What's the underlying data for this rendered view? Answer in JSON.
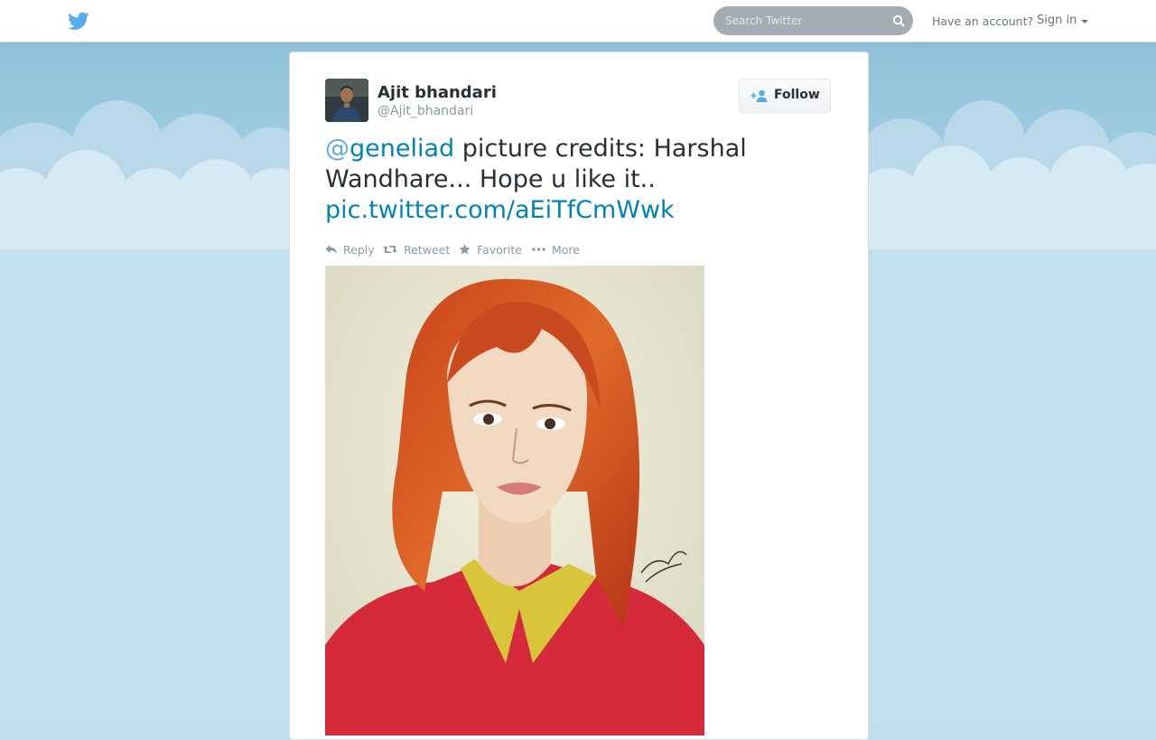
{
  "topbar": {
    "logo_icon": "twitter-bird-icon",
    "search_placeholder": "Search Twitter",
    "search_icon": "magnifier-icon",
    "have_account": "Have an account?",
    "sign_in": "Sign in",
    "sign_in_icon": "caret-down-icon"
  },
  "tweet": {
    "author": {
      "name": "Ajit bhandari",
      "handle": "@Ajit_bhandari"
    },
    "follow_label": "Follow",
    "text": {
      "mention_at": "@",
      "mention_name": "geneliad",
      "body": " picture credits: Harshal Wandhare... Hope u like it..",
      "link": "pic.twitter.com/aEiTfCmWwk"
    },
    "actions": [
      {
        "label": "Reply",
        "icon": "reply-icon"
      },
      {
        "label": "Retweet",
        "icon": "retweet-icon"
      },
      {
        "label": "Favorite",
        "icon": "star-icon"
      },
      {
        "label": "More",
        "icon": "ellipsis-icon"
      }
    ],
    "media": {
      "alt": "painted portrait"
    }
  },
  "colors": {
    "brand": "#55acee",
    "link": "#0084b4",
    "sky": "#c0deed",
    "muted": "#8899a6"
  }
}
